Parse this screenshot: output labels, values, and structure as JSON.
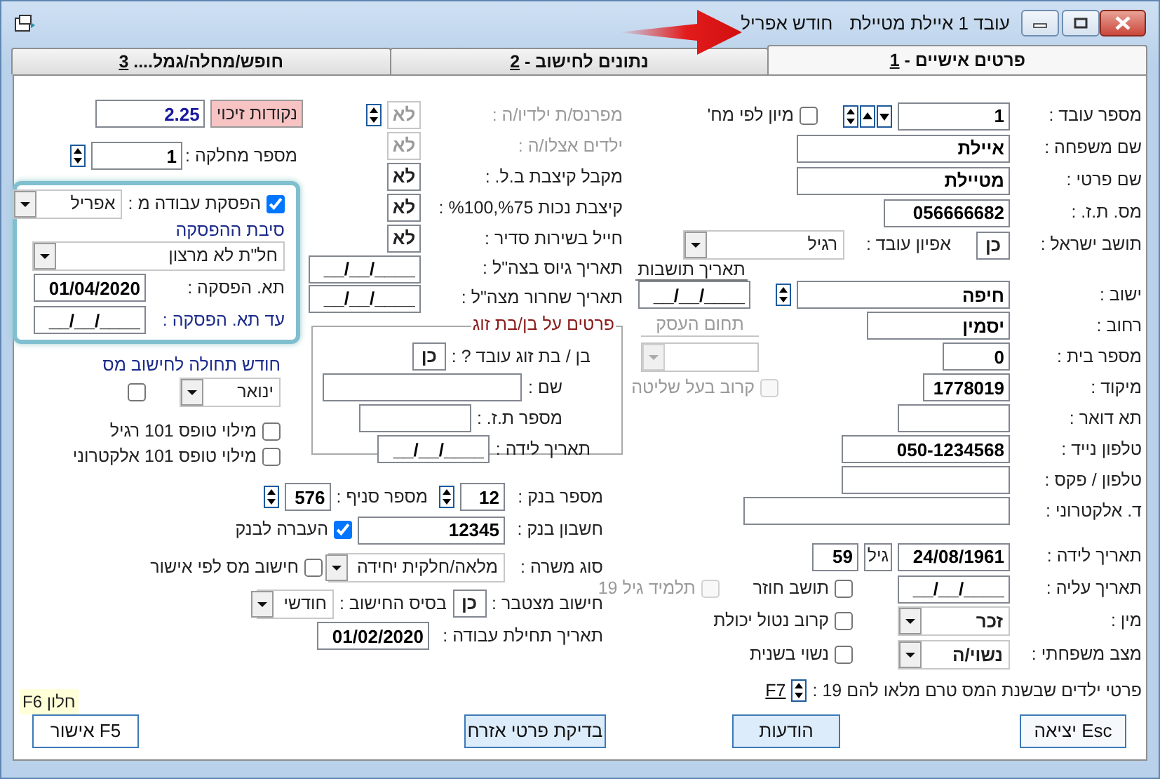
{
  "window": {
    "title": "עובד 1 איילת מטיילת",
    "month": "חודש אפריל"
  },
  "tabs": [
    {
      "label": "פרטים אישיים - ",
      "hotkey": "1",
      "selected": true
    },
    {
      "label": "נתונים לחישוב - ",
      "hotkey": "2",
      "selected": false
    },
    {
      "label": "חופש/מחלה/גמל.... ",
      "hotkey": "3",
      "selected": false
    }
  ],
  "personal": {
    "employee_no": {
      "label": "מספר עובד :",
      "value": "1"
    },
    "sort_by_department": {
      "label": "מיון לפי מח'",
      "checked": false
    },
    "last_name": {
      "label": "שם משפחה :",
      "value": "איילת"
    },
    "first_name": {
      "label": "שם פרטי :",
      "value": "מטיילת"
    },
    "id_number": {
      "label": "מס. ת.ז. :",
      "value": "056666682"
    },
    "israeli_resident": {
      "label": "תושב ישראל :",
      "value": "כן"
    },
    "employee_type": {
      "label": "אפיון עובד :",
      "value": "רגיל"
    },
    "residence_date": {
      "label": "תאריך תושבות",
      "value": "__/__/____"
    },
    "city": {
      "label": "ישוב :",
      "value": "חיפה"
    },
    "street": {
      "label": "רחוב :",
      "value": "יסמין"
    },
    "business_field": {
      "label": "תחום העסק",
      "disabled": true
    },
    "house_number": {
      "label": "מספר בית :",
      "value": "0"
    },
    "zip_code": {
      "label": "מיקוד :",
      "value": "1778019"
    },
    "controlling_relative": {
      "label": "קרוב בעל שליטה",
      "checked": false,
      "disabled": true
    },
    "po_box": {
      "label": "תא דואר :"
    },
    "mobile": {
      "label": "טלפון נייד :",
      "value": "050-1234568"
    },
    "phone_fax": {
      "label": "טלפון / פקס :"
    },
    "email": {
      "label": "ד. אלקטרוני :"
    },
    "birth_date": {
      "label": "תאריך לידה :",
      "value": "24/08/1961"
    },
    "age": {
      "label": "גיל",
      "value": "59"
    },
    "aliyah_date": {
      "label": "תאריך עליה :",
      "value": "__/__/____"
    },
    "returning_resident": {
      "label": "תושב חוזר",
      "checked": false
    },
    "student_19": {
      "label": "תלמיד גיל 19",
      "checked": false,
      "disabled": true
    },
    "gender": {
      "label": "מין :",
      "value": "זכר"
    },
    "disabled_relative": {
      "label": "קרוב נטול יכולת",
      "checked": false
    },
    "marital_status": {
      "label": "מצב משפחתי :",
      "value": "נשוי/ה"
    },
    "remarried": {
      "label": "נשוי בשנית",
      "checked": false
    },
    "children": {
      "label": "פרטי ילדים שבשנת המס טרם מלאו להם 19 :",
      "shortcut": "F7"
    }
  },
  "support": {
    "provider": {
      "label": "מפרנס/ת ילדיו/ה :",
      "value": "לא",
      "disabled": true
    },
    "children_with": {
      "label": "ילדים אצלו/ה :",
      "value": "לא",
      "disabled": true
    },
    "nii_pension": {
      "label": "מקבל קיצבת  ב.ל. :",
      "value": "לא",
      "disabled": false
    },
    "disability_pension": {
      "label": "קיצבת נכות %75,%100 :",
      "value": "לא",
      "disabled": false
    },
    "soldier": {
      "label": "חייל בשירות סדיר :",
      "value": "לא",
      "disabled": false
    },
    "enlist_date": {
      "label": "תאריך גיוס בצה\"ל :",
      "value": "__/__/____"
    },
    "discharge_date": {
      "label": "תאריך שחרור מצה\"ל :",
      "value": "__/__/____"
    }
  },
  "spouse": {
    "title": "פרטים על בן/בת זוג",
    "working": {
      "label": "בן / בת זוג עובד ? :",
      "value": "כן"
    },
    "name": {
      "label": "שם :"
    },
    "id_number": {
      "label": "מספר ת.ז. :"
    },
    "birth_date": {
      "label": "תאריך לידה :",
      "value": "__/__/____"
    }
  },
  "tax": {
    "credit_points": {
      "label": "נקודות זיכוי",
      "value": "2.25"
    },
    "department": {
      "label": "מספר מחלקה :",
      "value": "1"
    },
    "stop_work": {
      "label": "הפסקת עבודה מ :",
      "checked": true,
      "value": "אפריל"
    },
    "stop_reason": {
      "label": "סיבת ההפסקה",
      "value": "חל\"ת לא מרצון"
    },
    "stop_date": {
      "label": "תא. הפסקה :",
      "value": "01/04/2020"
    },
    "stop_until": {
      "label": "עד תא. הפסקה :",
      "value": "__/__/____"
    },
    "tax_month": {
      "label": "חודש תחולה לחישוב מס",
      "value": "ינואר",
      "checked": false
    },
    "form101_regular": {
      "label": "מילוי טופס 101 רגיל",
      "checked": false
    },
    "form101_electronic": {
      "label": "מילוי טופס 101 אלקטרוני",
      "checked": false
    }
  },
  "bank": {
    "bank_number": {
      "label": "מספר בנק :",
      "value": "12"
    },
    "branch": {
      "label": "מספר סניף :",
      "value": "576"
    },
    "account": {
      "label": "חשבון בנק :",
      "value": "12345"
    },
    "transfer": {
      "label": "העברה לבנק",
      "checked": true
    },
    "position_type": {
      "label": "סוג משרה :",
      "value": "מלאה/חלקית יחידה"
    },
    "tax_by_approval": {
      "label": "חישוב מס לפי אישור",
      "checked": false
    },
    "cumulative": {
      "label": "חישוב מצטבר :",
      "value": "כן"
    },
    "calc_basis": {
      "label": "בסיס החישוב :",
      "value": "חודשי"
    },
    "start_date": {
      "label": "תאריך תחילת עבודה :",
      "value": "01/02/2020"
    }
  },
  "footer": {
    "hint": "F6 חלון",
    "buttons": [
      {
        "label": "יציאה Esc"
      },
      {
        "label": "הודעות"
      },
      {
        "label": "בדיקת פרטי אזרח"
      },
      {
        "label": "אישור F5"
      }
    ]
  }
}
